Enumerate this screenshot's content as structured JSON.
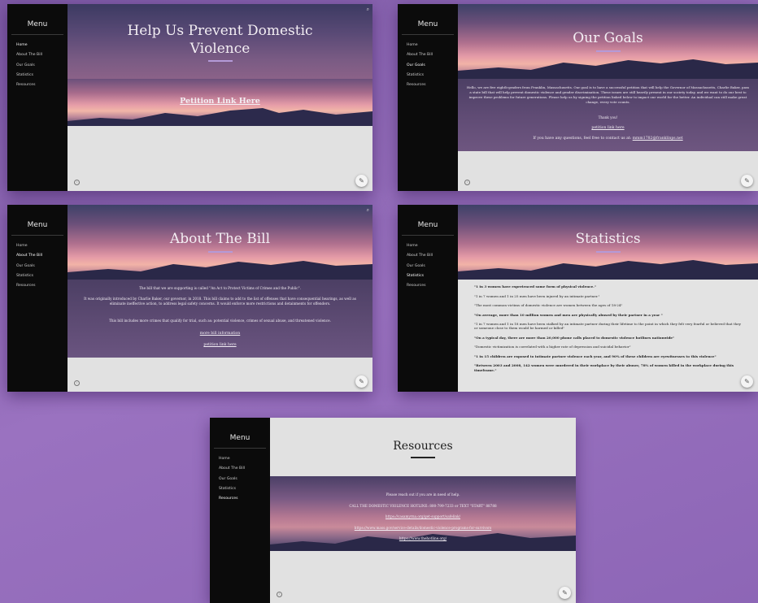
{
  "menu": {
    "title": "Menu",
    "items": [
      "Home",
      "About The Bill",
      "Our Goals",
      "Statistics",
      "Resources"
    ]
  },
  "home": {
    "title_line1": "Help Us Prevent Domestic",
    "title_line2": "Violence",
    "petition_link": "Petition Link Here"
  },
  "goals": {
    "title": "Our Goals",
    "paragraph": "Hello, we are five eighth-graders from Franklin, Massachusetts. Our goal is to have a successful petition that will help the Governor of Massachusetts, Charlie Baker, pass a state bill that will help prevent domestic violence and gender discrimination. These issues are still heavily present in our society today, and we want to do our best to improve these problems for future generations. Please help us by signing the petition linked below to impact our world for the better. An individual can still make great change, every vote counts.",
    "thanks": "Thank you!",
    "petition_link": "petition link here",
    "contact_prefix": "If you have any questions, feel free to contact us at:",
    "contact_email": "mmm1782@franklinps.net"
  },
  "bill": {
    "title": "About The Bill",
    "p1": "The bill that we are supporting is called \"An Act to Protect Victims of Crimes and the Public\".",
    "p2": "It was originally introduced by Charlie Baker, our governor, in 2018. This bill claims to add to the list of offenses that have consequential hearings, as well as eliminate ineffective action, to address legal safety concerns. It would enforce more restrictions and detainments for offenders.",
    "p3": "This bill includes more crimes that qualify for trial, such as: potential violence, crimes of sexual abuse, and threatened violence.",
    "link_more": "more bill information",
    "link_petition": "petition link here"
  },
  "statistics": {
    "title": "Statistics",
    "facts": [
      {
        "text": "\"1 in 3 women have experienced some form of physical violence.\"",
        "bold": true
      },
      {
        "text": "\"1 in 7 women and 1 in 25 men have been injured by an intimate partner.\"",
        "bold": false
      },
      {
        "text": "\"The most common victims of domestic violence are women between the ages of 18-24\"",
        "bold": false
      },
      {
        "text": "\"On average, more than 10 million women and men are physically abused by their partner in a year \"",
        "bold": true
      },
      {
        "text": "\"1 in 7 women and 1 in 18 men have been stalked by an intimate partner during their lifetime to the point in which they felt very fearful or believed that they or someone close to them would be harmed or killed\"",
        "bold": false
      },
      {
        "text": "\"On a typical day, there are more than 20,000 phone calls placed to domestic violence hotlines nationwide\"",
        "bold": true
      },
      {
        "text": "\"Domestic victimization is correlated with a higher rate of depression and suicidal behavior\"",
        "bold": false
      },
      {
        "text": "\"1 in 15 children are exposed to intimate partner violence each year, and 90% of these children are eyewitnesses to this violence\"",
        "bold": true
      },
      {
        "text": "\"Between 2003 and 2008, 142 women were murdered in their workplace by their abuser, 78% of women killed in the workplace during this timeframe.\"",
        "bold": true
      }
    ]
  },
  "resources": {
    "title": "Resources",
    "line1": "Please reach out if you are in need of help.",
    "line2": "CALL THE DOMESTIC VIOLENCE HOTLINE: 800-799-7233 or TEXT \"START\" 88788",
    "link1": "https://casamyrna.org/get-support/safelink/",
    "link2": "https://www.mass.gov/service-details/domestic-violence-programs-for-survivors",
    "link3": "https://www.thehotline.org/"
  },
  "icons": {
    "search": "search-icon",
    "info": "info-icon",
    "edit": "pencil-icon"
  },
  "colors": {
    "background": "#8e67b4",
    "sidebar": "#0b0b0b",
    "accent": "#b49ad8"
  }
}
